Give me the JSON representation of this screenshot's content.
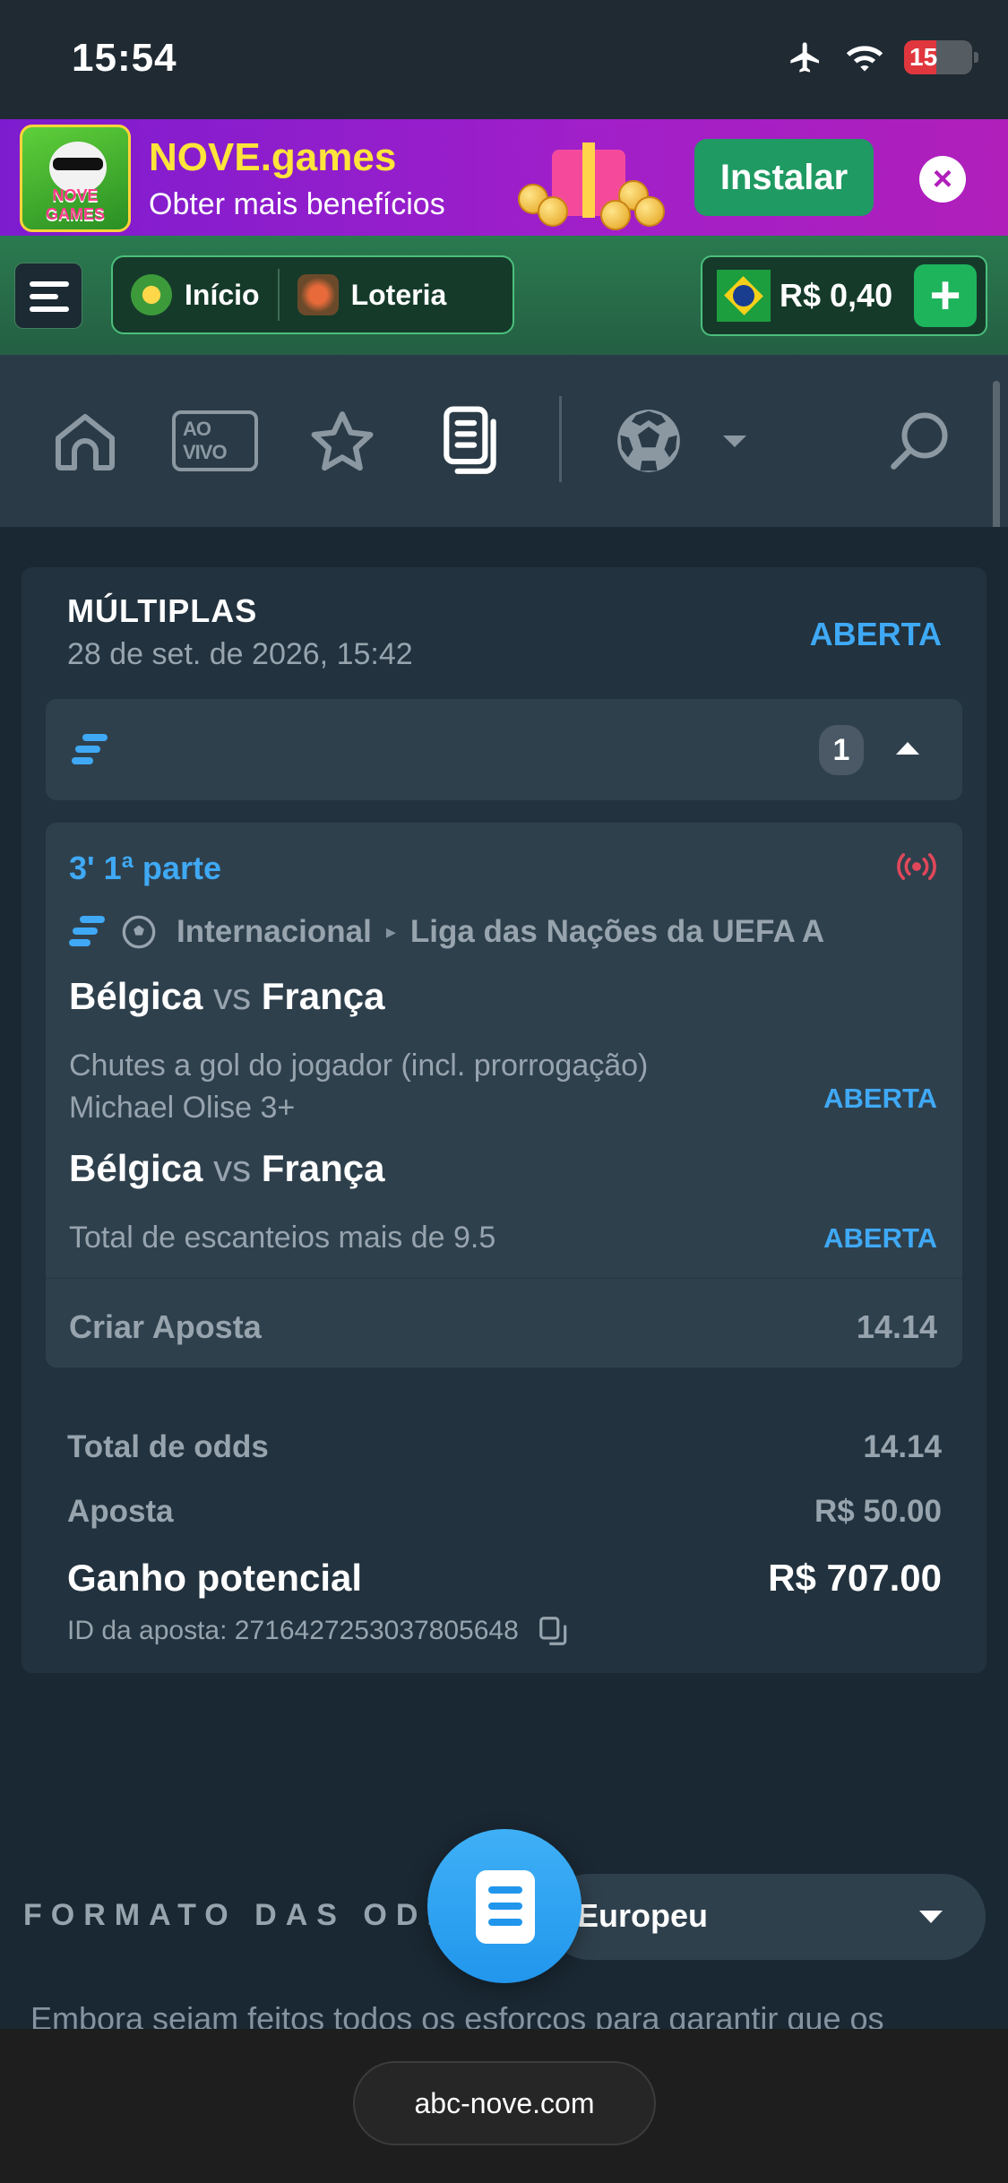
{
  "status_bar": {
    "time": "15:54",
    "battery": "15"
  },
  "promo": {
    "logo_text": "NOVE GAMES",
    "title": "NOVE.games",
    "subtitle": "Obter mais benefícios",
    "install_label": "Instalar",
    "close_symbol": "×"
  },
  "topnav": {
    "home_label": "Início",
    "lottery_label": "Loteria",
    "balance": "R$ 0,40",
    "add_symbol": "+"
  },
  "sportnav": {
    "live_label": "AO VIVO"
  },
  "bet": {
    "type": "MÚLTIPLAS",
    "date": "28 de set. de 2026, 15:42",
    "status": "ABERTA",
    "group_count": "1",
    "live_time": "3' 1ª parte",
    "league_country": "Internacional",
    "league_name": "Liga das Nações da UEFA A",
    "legs": [
      {
        "home": "Bélgica",
        "vs": "vs",
        "away": "França",
        "market_line1": "Chutes a gol do jogador (incl. prorrogação)",
        "market_line2": "Michael Olise 3+",
        "status": "ABERTA"
      },
      {
        "home": "Bélgica",
        "vs": "vs",
        "away": "França",
        "market_line1": "Total de escanteios mais de 9.5",
        "status": "ABERTA"
      }
    ],
    "create_bet_label": "Criar Aposta",
    "create_bet_odds": "14.14",
    "total_odds_label": "Total de odds",
    "total_odds": "14.14",
    "stake_label": "Aposta",
    "stake": "R$ 50.00",
    "potential_label": "Ganho potencial",
    "potential": "R$ 707.00",
    "bet_id": "ID da aposta: 2716427253037805648"
  },
  "odds_format": {
    "label": "FORMATO DAS ODDS",
    "value": "Europeu"
  },
  "disclaimer": "Embora sejam feitos todos os esforços para garantir que os",
  "browser": {
    "url": "abc-nove.com"
  },
  "colors": {
    "accent": "#3fa9f5",
    "green": "#1eb45c",
    "promo": "#a11fc9"
  }
}
